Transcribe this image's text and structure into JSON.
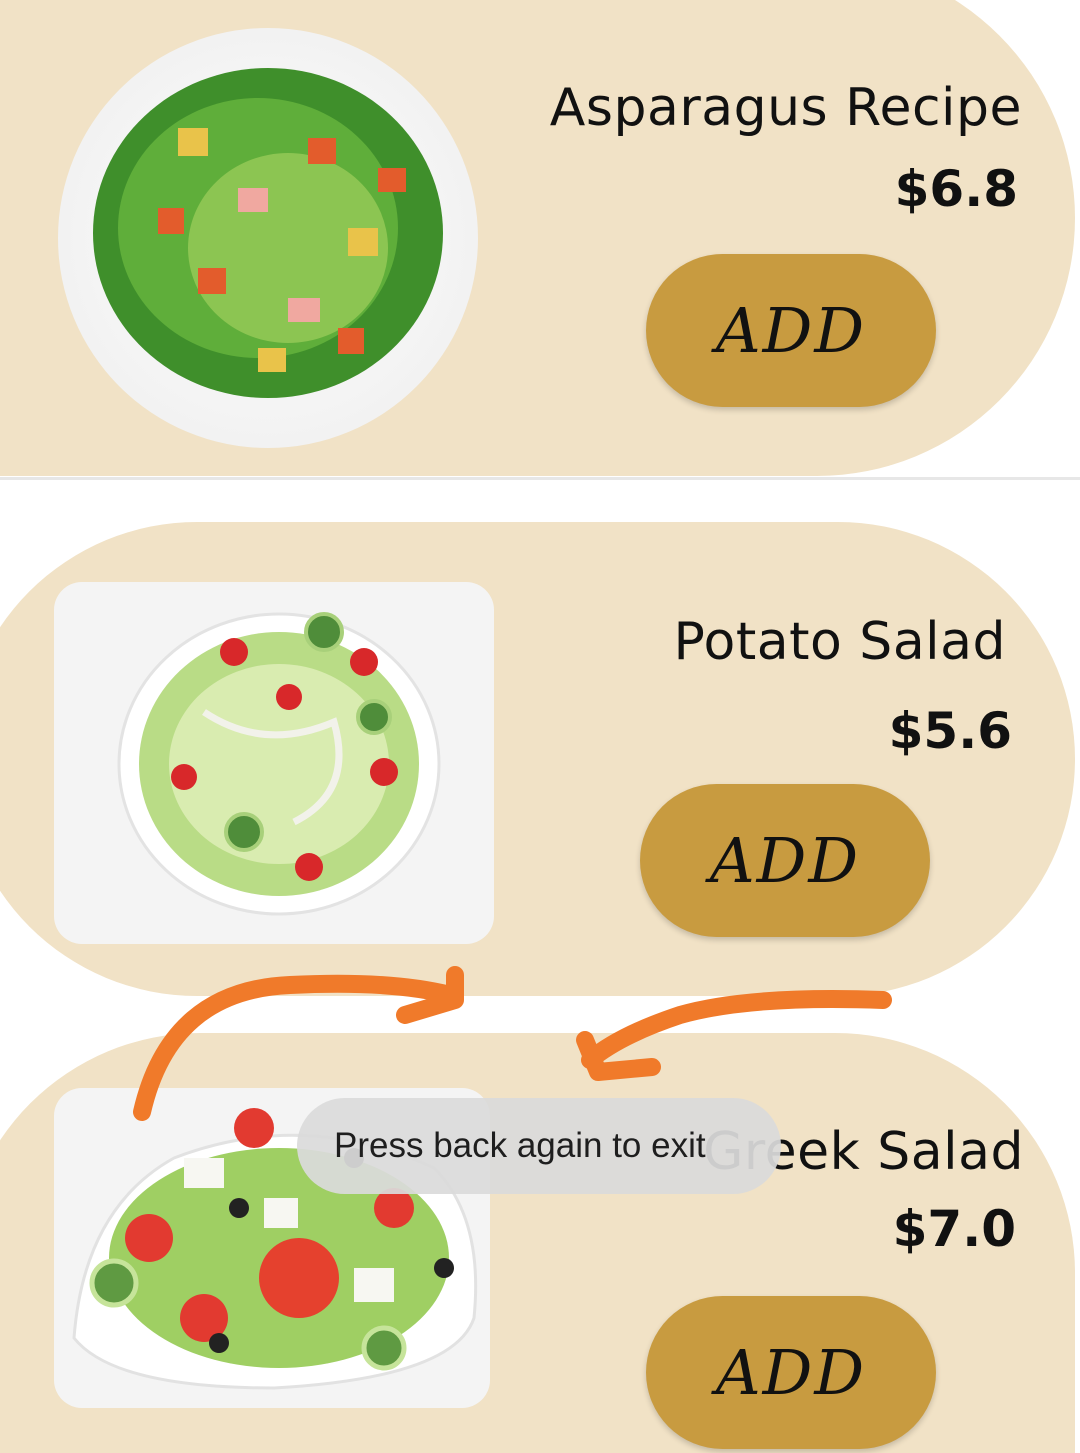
{
  "items": [
    {
      "name": "Asparagus Recipe",
      "price": "$6.8",
      "button": "ADD"
    },
    {
      "name": "Potato Salad",
      "price": "$5.6",
      "button": "ADD"
    },
    {
      "name": "Greek Salad",
      "price": "$7.0",
      "button": "ADD"
    }
  ],
  "toast": {
    "message": "Press back again to exit"
  },
  "colors": {
    "card_bg": "#f1e2c6",
    "button_bg": "#c89b40",
    "annotation": "#f07a2a"
  },
  "icons": [
    "salad-image",
    "arrow-annotation"
  ]
}
